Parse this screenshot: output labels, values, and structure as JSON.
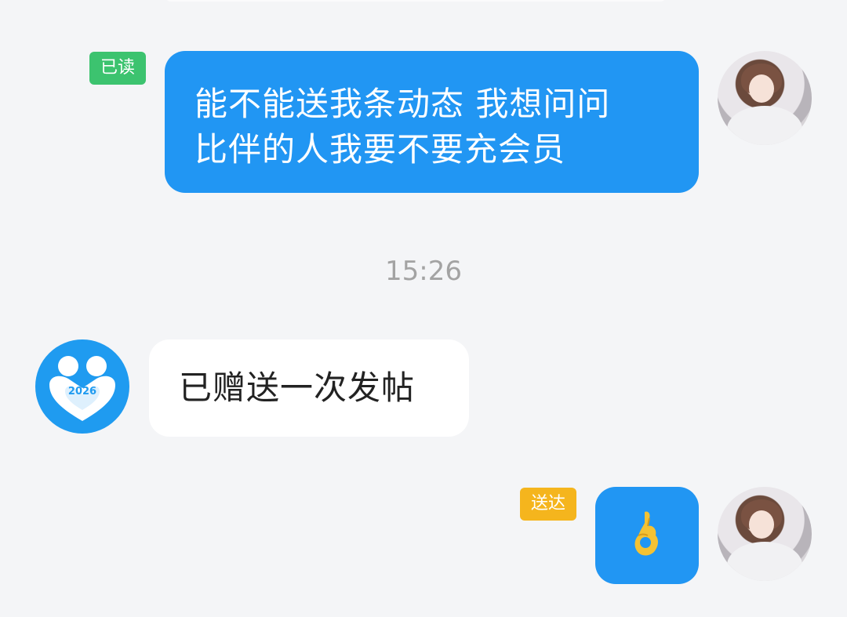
{
  "chat": {
    "messages": [
      {
        "sender": "me",
        "status": "已读",
        "status_color": "#3cc36f",
        "text_line1": "能不能送我条动态 我想问问",
        "text_line2": "比伴的人我要不要充会员"
      },
      {
        "type": "timestamp",
        "text": "15:26"
      },
      {
        "sender": "other",
        "avatar_label": "2026",
        "text": "已赠送一次发帖"
      },
      {
        "sender": "me",
        "status": "送达",
        "status_color": "#f5b51d",
        "emoji_icon": "ok-hand-emoji-icon"
      }
    ]
  },
  "colors": {
    "my_bubble": "#2196f3",
    "other_bubble": "#ffffff",
    "background": "#f4f5f7",
    "timestamp_text": "#a3a3a3"
  }
}
